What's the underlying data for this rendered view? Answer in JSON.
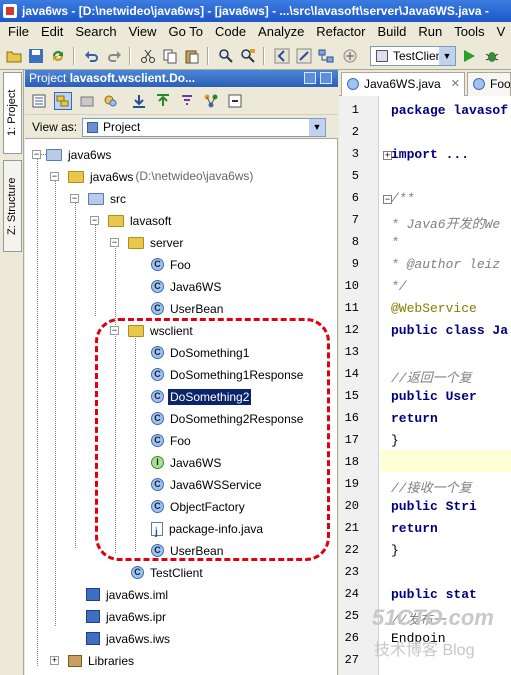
{
  "window": {
    "title": "java6ws - [D:\\netwideo\\java6ws] - [java6ws] - ...\\src\\lavasoft\\server\\Java6WS.java - "
  },
  "menu": [
    "File",
    "Edit",
    "Search",
    "View",
    "Go To",
    "Code",
    "Analyze",
    "Refactor",
    "Build",
    "Run",
    "Tools",
    "V"
  ],
  "toolbar": {
    "run_config": "TestClient"
  },
  "side_tabs": {
    "project": "1: Project",
    "structure": "Z: Structure"
  },
  "project_panel": {
    "header_prefix": "Project",
    "header_path": "lavasoft.wsclient.Do...",
    "view_as_label": "View as:",
    "view_as_value": "Project"
  },
  "tree": [
    {
      "label": "java6ws"
    },
    {
      "label": "java6ws",
      "sub": "(D:\\netwideo\\java6ws)"
    },
    {
      "label": "src"
    },
    {
      "label": "lavasoft"
    },
    {
      "label": "server"
    },
    {
      "label": "Foo"
    },
    {
      "label": "Java6WS"
    },
    {
      "label": "UserBean"
    },
    {
      "label": "wsclient"
    },
    {
      "label": "DoSomething1"
    },
    {
      "label": "DoSomething1Response"
    },
    {
      "label": "DoSomething2"
    },
    {
      "label": "DoSomething2Response"
    },
    {
      "label": "Foo"
    },
    {
      "label": "Java6WS"
    },
    {
      "label": "Java6WSService"
    },
    {
      "label": "ObjectFactory"
    },
    {
      "label": "package-info.java"
    },
    {
      "label": "UserBean"
    },
    {
      "label": "TestClient"
    },
    {
      "label": "java6ws.iml"
    },
    {
      "label": "java6ws.ipr"
    },
    {
      "label": "java6ws.iws"
    },
    {
      "label": "Libraries"
    }
  ],
  "editor": {
    "tabs": [
      "Java6WS.java",
      "Foo"
    ],
    "line_numbers": [
      "1",
      "2",
      "3",
      "5",
      "6",
      "7",
      "8",
      "9",
      "10",
      "11",
      "12",
      "13",
      "14",
      "15",
      "16",
      "17",
      "18",
      "19",
      "20",
      "21",
      "22",
      "23",
      "24",
      "25",
      "26",
      "27"
    ],
    "lines": [
      "package lavasof",
      "",
      "import ...",
      "",
      "/**",
      " * Java6开发的We",
      " *",
      " * @author leiz",
      " */",
      "@WebService",
      "public class Ja",
      "",
      "    //返回一个复",
      "    public User",
      "        return",
      "    }",
      "",
      "    //接收一个复",
      "    public Stri",
      "        return",
      "    }",
      "",
      "    public stat",
      "        //发布一",
      "        Endpoin",
      ""
    ]
  },
  "watermark": {
    "line1": "51CTO.com",
    "line2": "技术博客  Blog"
  }
}
